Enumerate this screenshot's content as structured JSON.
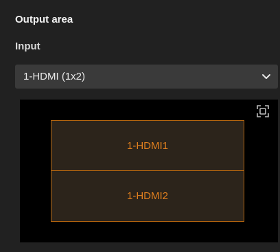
{
  "panel": {
    "title": "Output area",
    "input_label": "Input"
  },
  "input_select": {
    "value": "1-HDMI (1x2)",
    "icon": "chevron-down-icon"
  },
  "preview": {
    "fullscreen_icon": "fullscreen-icon",
    "zones": [
      {
        "label": "1-HDMI1"
      },
      {
        "label": "1-HDMI2"
      }
    ]
  },
  "colors": {
    "background": "#212121",
    "select_bg": "#3a3a3a",
    "preview_bg": "#000000",
    "accent": "#e07f1e",
    "zone_border": "#b5650e"
  }
}
